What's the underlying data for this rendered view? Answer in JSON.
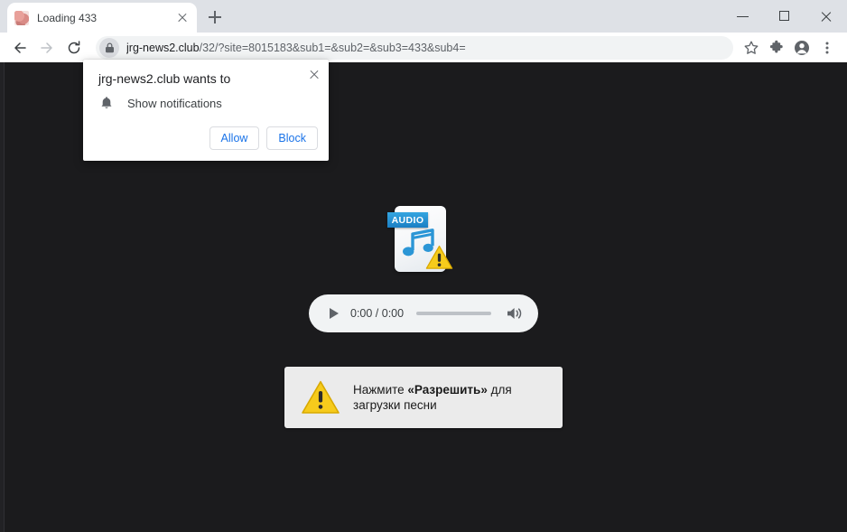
{
  "window": {
    "controls": {
      "minimize": "minimize-window-button",
      "maximize": "maximize-window-button",
      "close": "close-window-button"
    }
  },
  "tabstrip": {
    "tabs": [
      {
        "title": "Loading 433",
        "favicon": "site-favicon",
        "close_label": "close-tab"
      }
    ],
    "new_tab_label": "new-tab"
  },
  "toolbar": {
    "back_label": "Back",
    "forward_label": "Forward",
    "reload_label": "Reload",
    "security_icon": "lock-icon",
    "url_host": "jrg-news2.club",
    "url_path": "/32/?site=8015183&sub1=&sub2=&sub3=433&sub4=",
    "url_full": "jrg-news2.club/32/?site=8015183&sub1=&sub2=&sub3=433&sub4=",
    "bookmark_label": "Bookmark this tab",
    "extensions_label": "Extensions",
    "profile_label": "Profile",
    "menu_label": "Customize and control Google Chrome"
  },
  "permission_dialog": {
    "title": "jrg-news2.club wants to",
    "permission_icon": "bell-icon",
    "permission_label": "Show notifications",
    "allow_label": "Allow",
    "block_label": "Block",
    "close_label": "close-dialog"
  },
  "page": {
    "background_color": "#1b1b1d",
    "media_placeholder": {
      "badge": "AUDIO",
      "icon": "broken-audio-file-icon",
      "warning_icon": "warning-triangle-icon"
    },
    "audio_player": {
      "play_label": "play",
      "time": "0:00 / 0:00",
      "current_time": "0:00",
      "duration": "0:00",
      "progress_percent": 0,
      "volume_label": "volume"
    },
    "banner": {
      "warning_icon": "warning-triangle-icon",
      "line1_prefix": "Нажмите ",
      "line1_bold": "«Разрешить»",
      "line1_suffix": " для",
      "line2": "загрузки песни"
    }
  },
  "colors": {
    "accent_blue": "#1a73e8",
    "warning_yellow": "#f5c518",
    "audio_badge_blue": "#1b7fc4",
    "page_dark": "#1b1b1d",
    "tabstrip_gray": "#dee1e6"
  }
}
